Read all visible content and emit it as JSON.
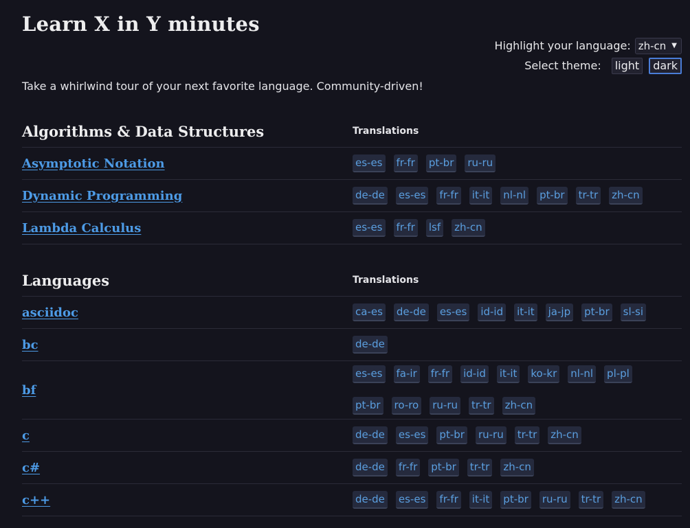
{
  "site": {
    "title": "Learn X in Y minutes",
    "tagline": "Take a whirlwind tour of your next favorite language. Community-driven!"
  },
  "controls": {
    "highlight_label": "Highlight your language:",
    "highlight_value": "zh-cn",
    "theme_label": "Select theme:",
    "theme_light": "light",
    "theme_dark": "dark",
    "active_theme": "dark"
  },
  "sections": [
    {
      "title": "Algorithms & Data Structures",
      "translations_label": "Translations",
      "rows": [
        {
          "name": "Asymptotic Notation",
          "tags": [
            "es-es",
            "fr-fr",
            "pt-br",
            "ru-ru"
          ]
        },
        {
          "name": "Dynamic Programming",
          "tags": [
            "de-de",
            "es-es",
            "fr-fr",
            "it-it",
            "nl-nl",
            "pt-br",
            "tr-tr",
            "zh-cn"
          ]
        },
        {
          "name": "Lambda Calculus",
          "tags": [
            "es-es",
            "fr-fr",
            "lsf",
            "zh-cn"
          ]
        }
      ]
    },
    {
      "title": "Languages",
      "translations_label": "Translations",
      "rows": [
        {
          "name": "asciidoc",
          "tags": [
            "ca-es",
            "de-de",
            "es-es",
            "id-id",
            "it-it",
            "ja-jp",
            "pt-br",
            "sl-si"
          ]
        },
        {
          "name": "bc",
          "tags": [
            "de-de"
          ]
        },
        {
          "name": "bf",
          "tags": [
            "es-es",
            "fa-ir",
            "fr-fr",
            "id-id",
            "it-it",
            "ko-kr",
            "nl-nl",
            "pl-pl",
            "pt-br",
            "ro-ro",
            "ru-ru",
            "tr-tr",
            "zh-cn"
          ]
        },
        {
          "name": "c",
          "tags": [
            "de-de",
            "es-es",
            "pt-br",
            "ru-ru",
            "tr-tr",
            "zh-cn"
          ]
        },
        {
          "name": "c#",
          "tags": [
            "de-de",
            "fr-fr",
            "pt-br",
            "tr-tr",
            "zh-cn"
          ]
        },
        {
          "name": "c++",
          "tags": [
            "de-de",
            "es-es",
            "fr-fr",
            "it-it",
            "pt-br",
            "ru-ru",
            "tr-tr",
            "zh-cn"
          ]
        }
      ]
    }
  ],
  "colors": {
    "background": "#14141d",
    "link": "#4d9be6",
    "tag_background": "#252a3d",
    "active_border": "#4a7dd8"
  }
}
